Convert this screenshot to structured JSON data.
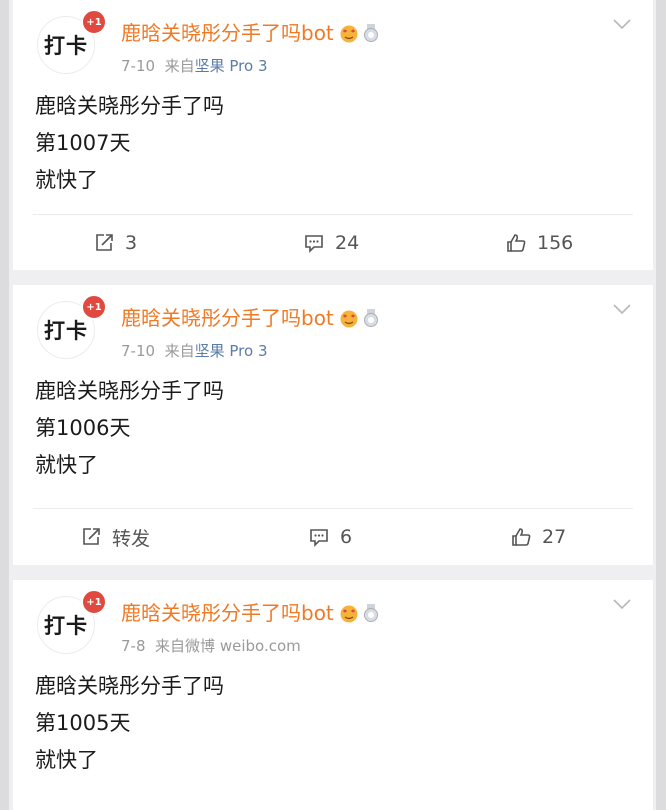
{
  "colors": {
    "username": "#ef7a26",
    "source_link": "#5b7ca8",
    "badge": "#e0493f",
    "meta": "#9a9a9a"
  },
  "posts": [
    {
      "avatar_text": "打卡",
      "avatar_badge": "+1",
      "username": "鹿晗关晓彤分手了吗bot",
      "date": "7-10",
      "source_prefix": "来自",
      "source": "坚果 Pro 3",
      "lines": [
        "鹿晗关晓彤分手了吗",
        "第1007天",
        "就快了"
      ],
      "repost_label": "3",
      "comment_count": "24",
      "like_count": "156"
    },
    {
      "avatar_text": "打卡",
      "avatar_badge": "+1",
      "username": "鹿晗关晓彤分手了吗bot",
      "date": "7-10",
      "source_prefix": "来自",
      "source": "坚果 Pro 3",
      "lines": [
        "鹿晗关晓彤分手了吗",
        "第1006天",
        "就快了"
      ],
      "repost_label": "转发",
      "comment_count": "6",
      "like_count": "27"
    },
    {
      "avatar_text": "打卡",
      "avatar_badge": "+1",
      "username": "鹿晗关晓彤分手了吗bot",
      "date": "7-8",
      "source_prefix": "来自微博",
      "source": "weibo.com",
      "lines": [
        "鹿晗关晓彤分手了吗",
        "第1005天",
        "就快了"
      ]
    }
  ]
}
